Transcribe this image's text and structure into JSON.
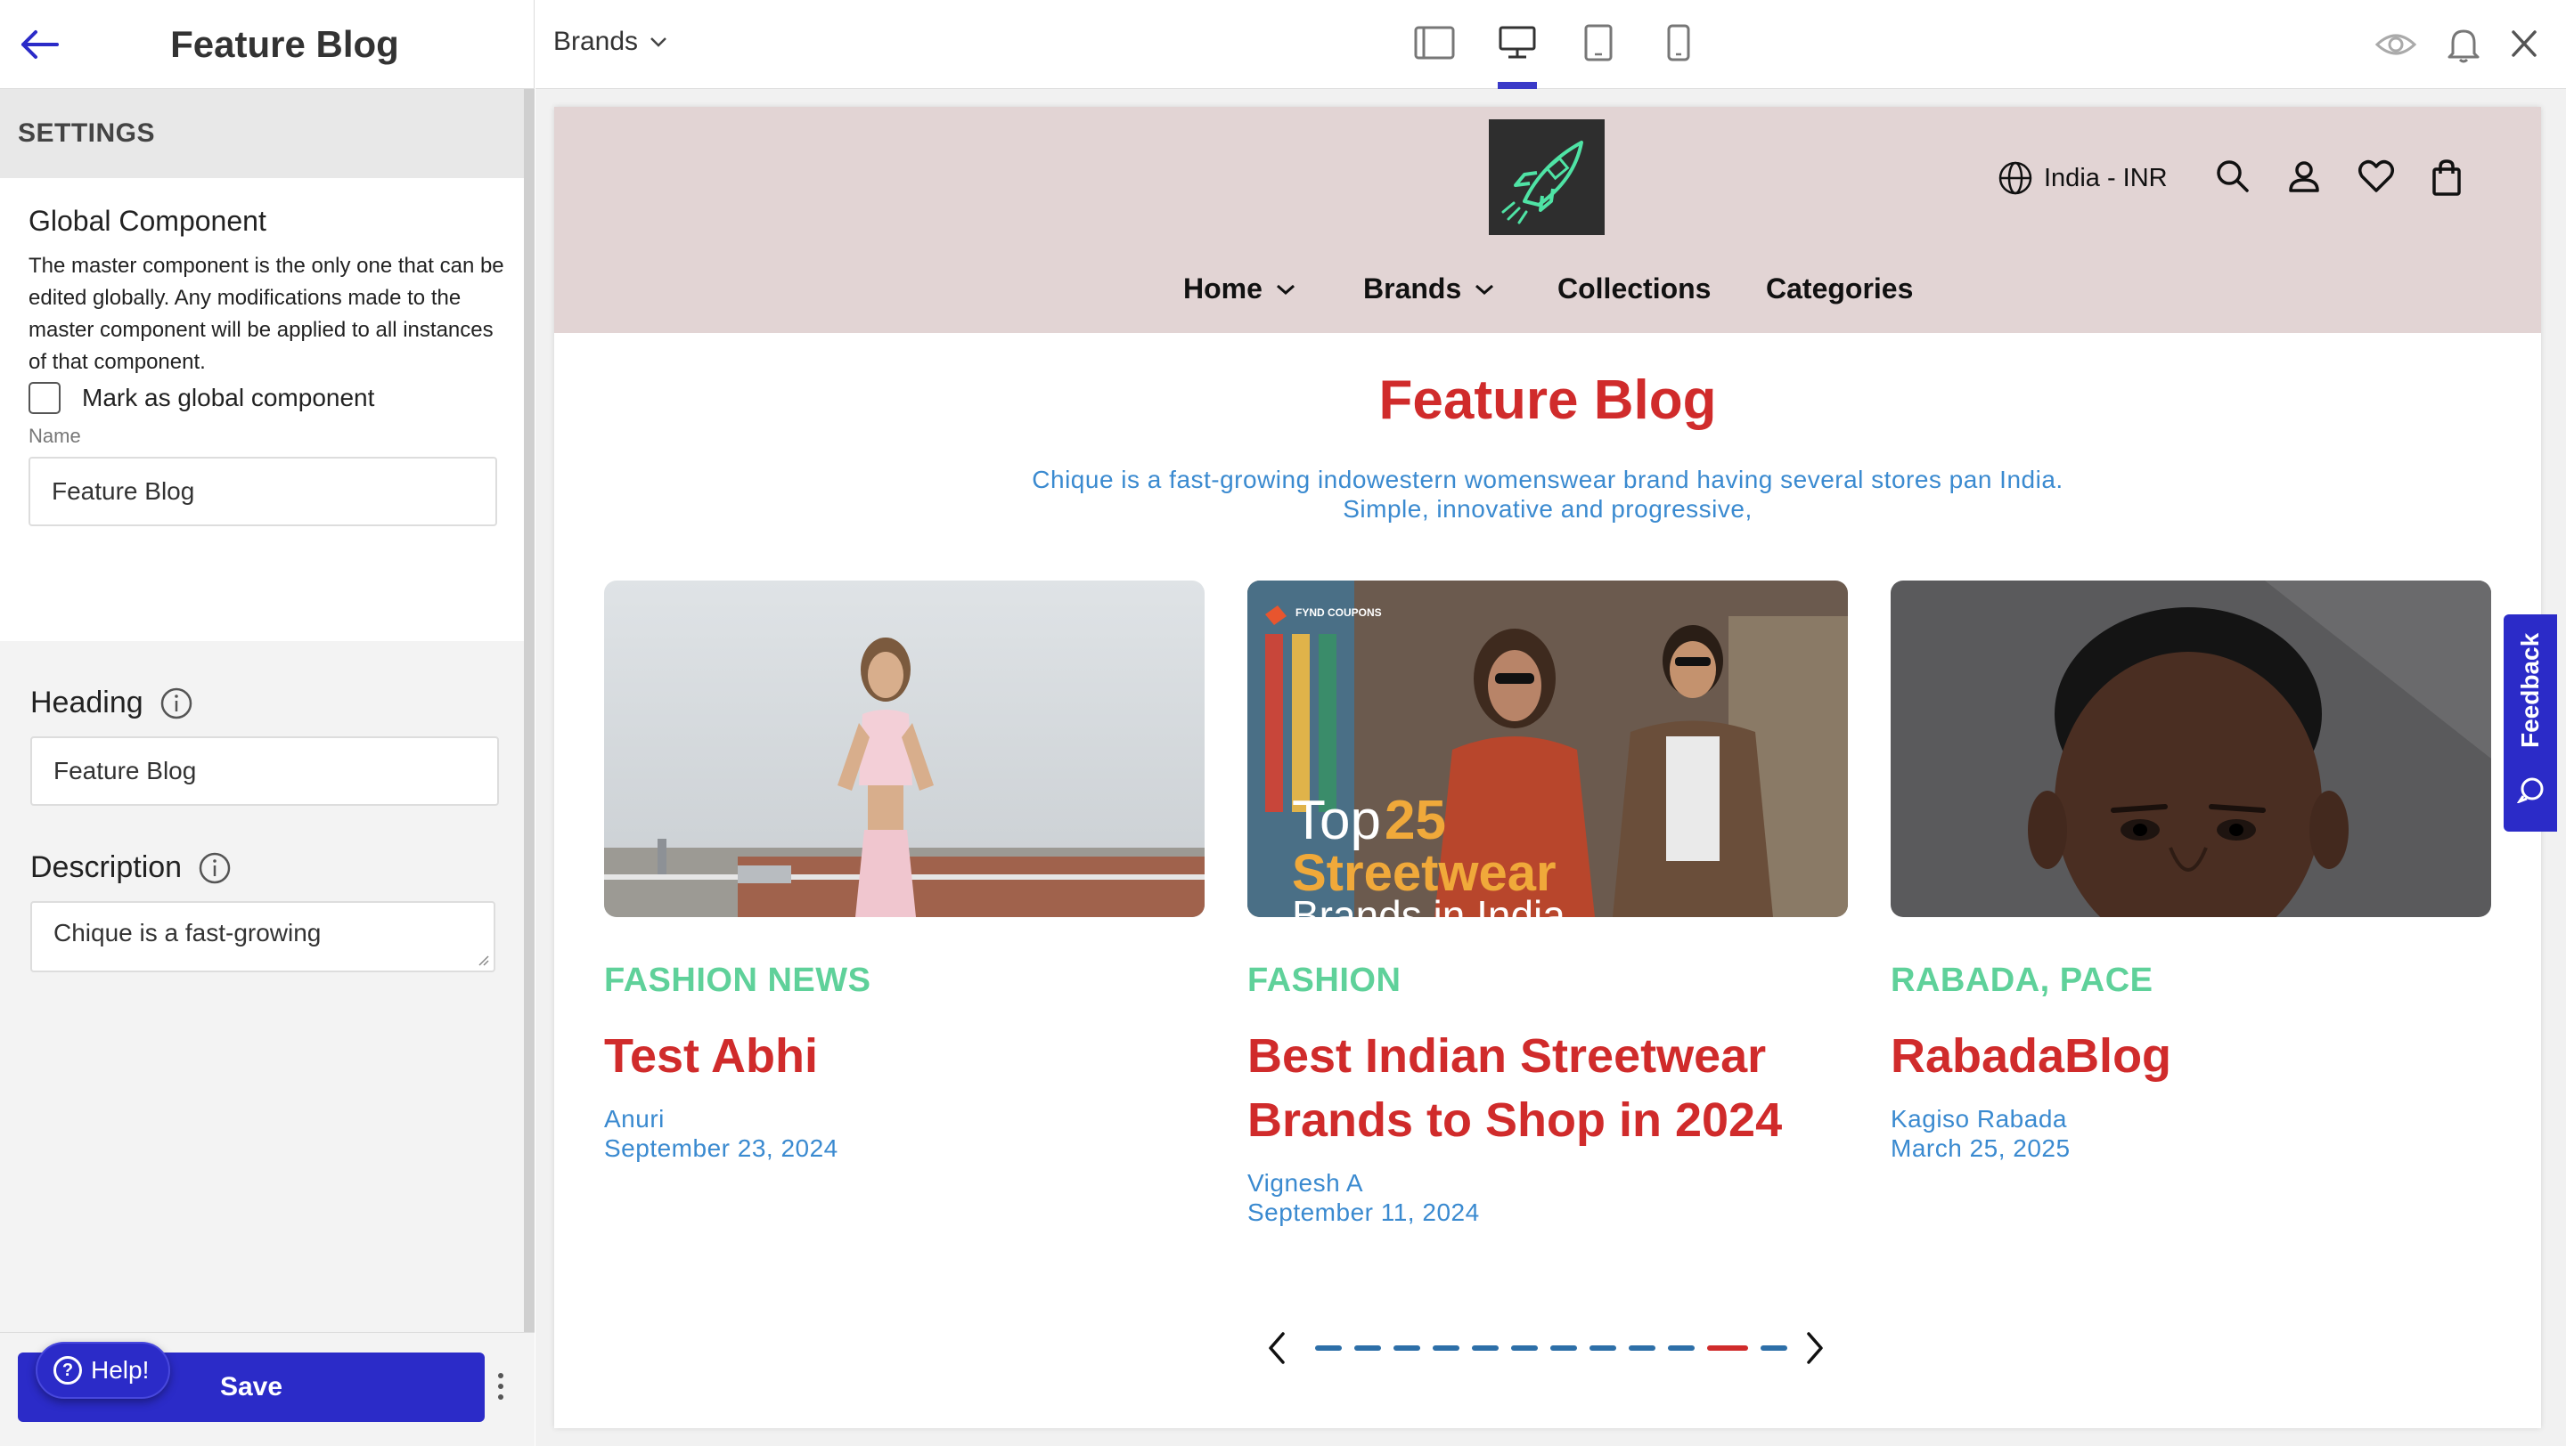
{
  "sidebar": {
    "title": "Feature Blog",
    "section_label": "SETTINGS",
    "global_component": {
      "heading": "Global Component",
      "description": "The master component is the only one that can be edited globally. Any modifications made to the master component will be applied to all instances of that component.",
      "checkbox_label": "Mark as global component",
      "checked": false,
      "name_label": "Name",
      "name_value": "Feature Blog"
    },
    "heading_label": "Heading",
    "heading_value": "Feature Blog",
    "description_label": "Description",
    "description_value": "Chique is a fast-growing",
    "save_label": "Save",
    "help_label": "Help!",
    "help_icon": "?"
  },
  "topbar": {
    "brand_dropdown": "Brands",
    "devices": [
      "tablet-landscape-icon",
      "desktop-icon",
      "tablet-icon",
      "mobile-icon"
    ],
    "active_device": "desktop-icon",
    "right_icons": [
      "eye-icon",
      "bell-icon",
      "close-icon"
    ]
  },
  "site": {
    "locale": "India - INR",
    "header_icons": [
      "search-icon",
      "user-icon",
      "heart-icon",
      "bag-icon"
    ],
    "nav": [
      {
        "label": "Home",
        "has_dropdown": true
      },
      {
        "label": "Brands",
        "has_dropdown": true
      },
      {
        "label": "Collections",
        "has_dropdown": false
      },
      {
        "label": "Categories",
        "has_dropdown": false
      }
    ],
    "feature_title": "Feature Blog",
    "feature_desc_line1": "Chique is a fast-growing indowestern womenswear brand having several stores pan India.",
    "feature_desc_line2": "Simple, innovative and progressive,",
    "cards": [
      {
        "category": "FASHION NEWS",
        "title": "Test Abhi",
        "author": "Anuri",
        "date": "September 23, 2024"
      },
      {
        "category": "FASHION",
        "title": "Best Indian Streetwear Brands to Shop in 2024",
        "author": "Vignesh A",
        "date": "September 11, 2024",
        "image_text": {
          "brand": "FYND COUPONS",
          "top": "Top",
          "num": "25",
          "line2": "Streetwear",
          "line3": "Brands in India"
        }
      },
      {
        "category": "RABADA, PACE",
        "title": "RabadaBlog",
        "author": "Kagiso Rabada",
        "date": "March 25, 2025"
      }
    ],
    "carousel": {
      "total": 12,
      "active_index": 10
    },
    "feedback_label": "Feedback"
  },
  "colors": {
    "accent": "#2b2bc8",
    "header_bg": "#e2d4d4",
    "title_red": "#d02b2b",
    "desc_blue": "#3a8ad0",
    "category_green": "#5fd19a"
  }
}
